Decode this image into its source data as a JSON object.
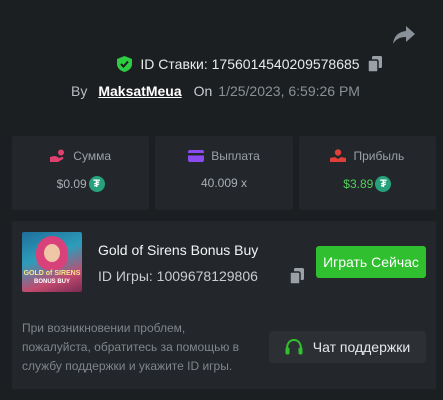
{
  "header": {
    "bet_id_label": "ID Ставки:",
    "bet_id_value": "1756014540209578685",
    "by_label": "By",
    "username": "MaksatMeua",
    "on_label": "On",
    "datetime": "1/25/2023, 6:59:26 PM",
    "icons": {
      "verified": "shield-check-icon",
      "copy": "copy-icon",
      "share": "share-arrow-icon"
    }
  },
  "stats": [
    {
      "label": "Сумма",
      "value": "$0.09",
      "icon": "coins-hand-icon",
      "currency_icon": "tether-icon",
      "currency_symbol": "₮"
    },
    {
      "label": "Выплата",
      "value": "40.009 x",
      "icon": "wallet-card-icon"
    },
    {
      "label": "Прибыль",
      "value": "$3.89",
      "icon": "profit-hand-icon",
      "currency_icon": "tether-icon",
      "currency_symbol": "₮"
    }
  ],
  "game": {
    "title": "Gold of Sirens Bonus Buy",
    "id_text": "ID Игры: 1009678129806",
    "thumb_text_1": "GOLD of SIRENS",
    "thumb_text_2": "BONUS BUY",
    "play_button": "Играть Сейчас"
  },
  "support": {
    "help_text": "При возникновении проблем, пожалуйста, обратитесь за помощью в службу поддержки и укажите ID игры.",
    "button_label": "Чат поддержки",
    "icon": "headset-icon"
  },
  "colors": {
    "background": "#1c1f22",
    "panel": "#23272b",
    "accent_green": "#2fbf2f",
    "profit_green": "#4ed15a",
    "verified_green": "#2ecc40",
    "tether": "#26a17b",
    "stat_icon_pink": "#e0406e",
    "stat_icon_purple": "#8a4cf0",
    "stat_icon_red": "#e0403a"
  }
}
